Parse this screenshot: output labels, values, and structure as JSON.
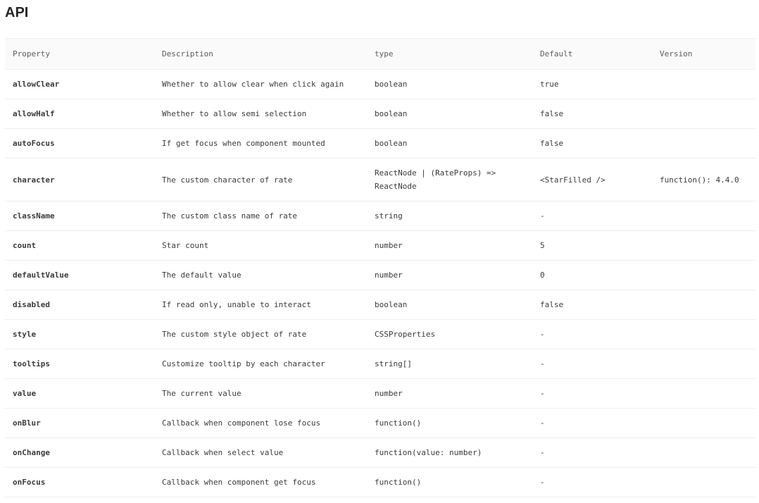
{
  "heading": "API",
  "columns": [
    "Property",
    "Description",
    "type",
    "Default",
    "Version"
  ],
  "rows": [
    {
      "property": "allowClear",
      "description": "Whether to allow clear when click again",
      "type": "boolean",
      "default": "true",
      "version": ""
    },
    {
      "property": "allowHalf",
      "description": "Whether to allow semi selection",
      "type": "boolean",
      "default": "false",
      "version": ""
    },
    {
      "property": "autoFocus",
      "description": "If get focus when component mounted",
      "type": "boolean",
      "default": "false",
      "version": ""
    },
    {
      "property": "character",
      "description": "The custom character of rate",
      "type": "ReactNode | (RateProps) => ReactNode",
      "default": "<StarFilled />",
      "version": "function(): 4.4.0"
    },
    {
      "property": "className",
      "description": "The custom class name of rate",
      "type": "string",
      "default": "-",
      "version": ""
    },
    {
      "property": "count",
      "description": "Star count",
      "type": "number",
      "default": "5",
      "version": ""
    },
    {
      "property": "defaultValue",
      "description": "The default value",
      "type": "number",
      "default": "0",
      "version": ""
    },
    {
      "property": "disabled",
      "description": "If read only, unable to interact",
      "type": "boolean",
      "default": "false",
      "version": ""
    },
    {
      "property": "style",
      "description": "The custom style object of rate",
      "type": "CSSProperties",
      "default": "-",
      "version": ""
    },
    {
      "property": "tooltips",
      "description": "Customize tooltip by each character",
      "type": "string[]",
      "default": "-",
      "version": ""
    },
    {
      "property": "value",
      "description": "The current value",
      "type": "number",
      "default": "-",
      "version": ""
    },
    {
      "property": "onBlur",
      "description": "Callback when component lose focus",
      "type": "function()",
      "default": "-",
      "version": ""
    },
    {
      "property": "onChange",
      "description": "Callback when select value",
      "type": "function(value: number)",
      "default": "-",
      "version": ""
    },
    {
      "property": "onFocus",
      "description": "Callback when component get focus",
      "type": "function()",
      "default": "-",
      "version": ""
    }
  ],
  "colors": {
    "type_text": "#c41d7f",
    "header_bg": "#fafafa",
    "row_border": "#eeeeee"
  }
}
